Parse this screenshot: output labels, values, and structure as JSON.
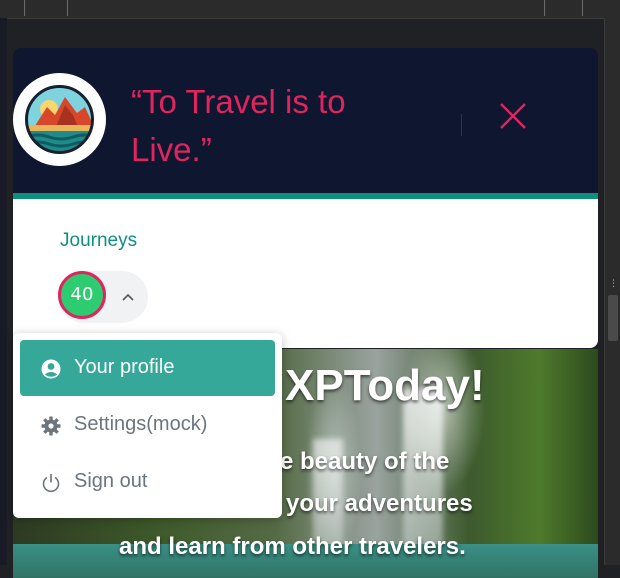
{
  "header": {
    "quote": "“To Travel is to Live.”",
    "logo_icon": "sunset-mountains-logo",
    "close_icon": "close-icon"
  },
  "card": {
    "journeys_label": "Journeys",
    "journeys_count": "40"
  },
  "hero": {
    "title_fragment": "XPToday!",
    "line1_fragment": "e beauty of the",
    "line2_fragment": "your adventures",
    "line3": "and learn from other travelers."
  },
  "menu": {
    "items": [
      {
        "label": "Your profile",
        "icon": "user-circle-icon",
        "active": true
      },
      {
        "label": "Settings(mock)",
        "icon": "gear-icon",
        "active": false
      },
      {
        "label": "Sign out",
        "icon": "power-icon",
        "active": false
      }
    ]
  },
  "colors": {
    "accent_pink": "#e0245e",
    "teal": "#0f8f80",
    "active_teal": "#35a89a",
    "badge_green": "#2ecc71",
    "header_navy": "#0e1630"
  }
}
